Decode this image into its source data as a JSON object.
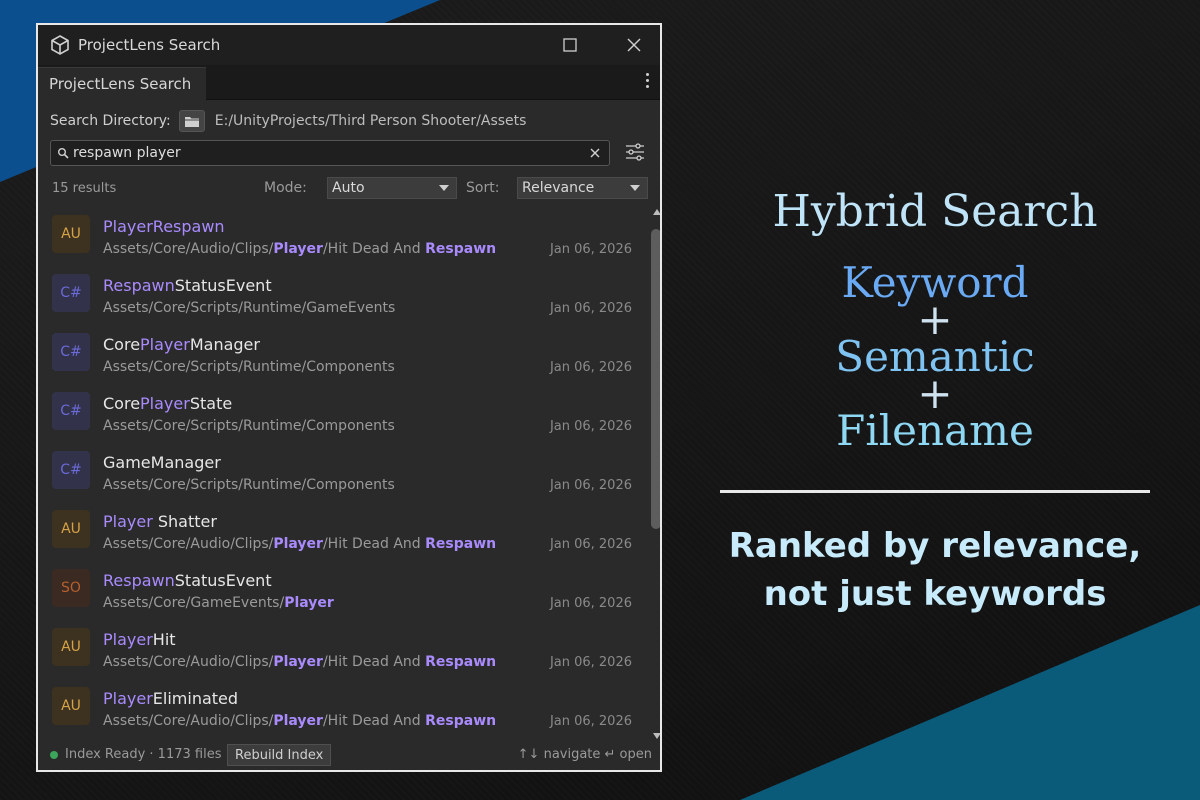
{
  "window": {
    "title": "ProjectLens Search",
    "tab_label": "ProjectLens Search"
  },
  "search_directory": {
    "label": "Search Directory:",
    "path": "E:/UnityProjects/Third Person Shooter/Assets"
  },
  "search": {
    "query": "respawn player",
    "placeholder": ""
  },
  "toolbar": {
    "results_count": "15 results",
    "mode_label": "Mode:",
    "mode_value": "Auto",
    "sort_label": "Sort:",
    "sort_value": "Relevance"
  },
  "results": [
    {
      "type": "AU",
      "name": [
        [
          "PlayerRespawn",
          true
        ]
      ],
      "path": [
        [
          "Assets/Core/Audio/Clips/",
          false
        ],
        [
          "Player",
          true
        ],
        [
          "/Hit Dead And ",
          false
        ],
        [
          "Respawn",
          true
        ]
      ],
      "date": "Jan 06, 2026"
    },
    {
      "type": "C#",
      "name": [
        [
          "Respawn",
          true
        ],
        [
          "StatusEvent",
          false
        ]
      ],
      "path": [
        [
          "Assets/Core/Scripts/Runtime/GameEvents",
          false
        ]
      ],
      "date": "Jan 06, 2026"
    },
    {
      "type": "C#",
      "name": [
        [
          "Core",
          false
        ],
        [
          "Player",
          true
        ],
        [
          "Manager",
          false
        ]
      ],
      "path": [
        [
          "Assets/Core/Scripts/Runtime/Components",
          false
        ]
      ],
      "date": "Jan 06, 2026"
    },
    {
      "type": "C#",
      "name": [
        [
          "Core",
          false
        ],
        [
          "Player",
          true
        ],
        [
          "State",
          false
        ]
      ],
      "path": [
        [
          "Assets/Core/Scripts/Runtime/Components",
          false
        ]
      ],
      "date": "Jan 06, 2026"
    },
    {
      "type": "C#",
      "name": [
        [
          "GameManager",
          false
        ]
      ],
      "path": [
        [
          "Assets/Core/Scripts/Runtime/Components",
          false
        ]
      ],
      "date": "Jan 06, 2026"
    },
    {
      "type": "AU",
      "name": [
        [
          "Player",
          true
        ],
        [
          " Shatter",
          false
        ]
      ],
      "path": [
        [
          "Assets/Core/Audio/Clips/",
          false
        ],
        [
          "Player",
          true
        ],
        [
          "/Hit Dead And ",
          false
        ],
        [
          "Respawn",
          true
        ]
      ],
      "date": "Jan 06, 2026"
    },
    {
      "type": "SO",
      "name": [
        [
          "Respawn",
          true
        ],
        [
          "StatusEvent",
          false
        ]
      ],
      "path": [
        [
          "Assets/Core/GameEvents/",
          false
        ],
        [
          "Player",
          true
        ]
      ],
      "date": "Jan 06, 2026"
    },
    {
      "type": "AU",
      "name": [
        [
          "Player",
          true
        ],
        [
          "Hit",
          false
        ]
      ],
      "path": [
        [
          "Assets/Core/Audio/Clips/",
          false
        ],
        [
          "Player",
          true
        ],
        [
          "/Hit Dead And ",
          false
        ],
        [
          "Respawn",
          true
        ]
      ],
      "date": "Jan 06, 2026"
    },
    {
      "type": "AU",
      "name": [
        [
          "Player",
          true
        ],
        [
          "Eliminated",
          false
        ]
      ],
      "path": [
        [
          "Assets/Core/Audio/Clips/",
          false
        ],
        [
          "Player",
          true
        ],
        [
          "/Hit Dead And ",
          false
        ],
        [
          "Respawn",
          true
        ]
      ],
      "date": "Jan 06, 2026"
    }
  ],
  "statusbar": {
    "status_text": "Index Ready · 1173 files",
    "rebuild_label": "Rebuild Index",
    "hint": "↑↓ navigate ↵ open",
    "status_color": "#3ba55c"
  },
  "promo": {
    "title": "Hybrid Search",
    "word1": "Keyword",
    "plus1": "+",
    "word2": "Semantic",
    "plus2": "+",
    "word3": "Filename",
    "tagline_line1": "Ranked by relevance,",
    "tagline_line2": "not just keywords"
  },
  "colors": {
    "highlight": "#a98bff",
    "accent_blue": "#0b4f8f",
    "accent_teal": "#0a5a7a"
  },
  "icons": {
    "app": "unity-cube-icon",
    "maximize": "maximize-icon",
    "close": "close-icon",
    "folder": "folder-icon",
    "search": "search-icon",
    "clear": "clear-icon",
    "filter": "sliders-icon"
  }
}
